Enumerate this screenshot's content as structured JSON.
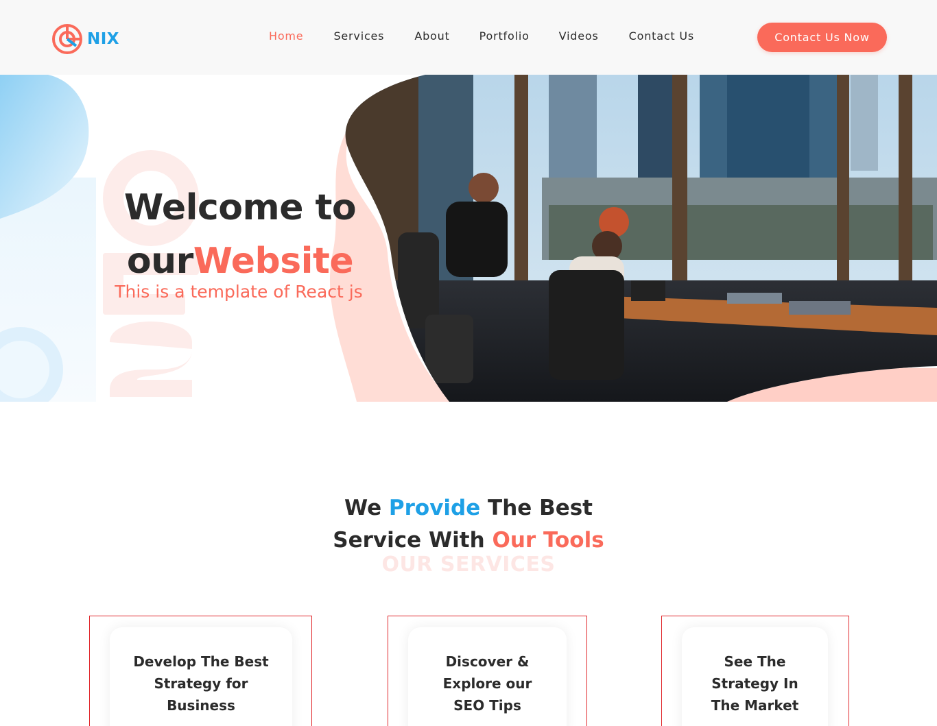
{
  "brand": {
    "name": "NIX",
    "logo_icon": "target-chart-icon",
    "primary_color": "#1ea0e6",
    "accent_color": "#fa6a5a"
  },
  "nav": {
    "items": [
      {
        "label": "Home",
        "active": true
      },
      {
        "label": "Services",
        "active": false
      },
      {
        "label": "About",
        "active": false
      },
      {
        "label": "Portfolio",
        "active": false
      },
      {
        "label": "Videos",
        "active": false
      },
      {
        "label": "Contact Us",
        "active": false
      }
    ],
    "cta_label": "Contact Us Now"
  },
  "hero": {
    "title_line1": "Welcome to",
    "title_prefix": "our",
    "title_accent": "Website",
    "subtitle": "This is a template of React js",
    "watermark": "SEO",
    "photo_alt": "Office workers at desks by large windows overlooking city skyscrapers"
  },
  "services": {
    "heading_we": "We ",
    "heading_provide": "Provide",
    "heading_rest1": " The Best",
    "heading_line2": "Service With ",
    "heading_tools": "Our Tools",
    "ghost_label": "OUR SERVICES",
    "cards": [
      {
        "line1": "Develop The Best",
        "line2": "Strategy for",
        "line3": "Business"
      },
      {
        "line1": "Discover &",
        "line2": "Explore our",
        "line3": "SEO Tips"
      },
      {
        "line1": "See The",
        "line2": "Strategy In",
        "line3": "The Market"
      }
    ]
  }
}
